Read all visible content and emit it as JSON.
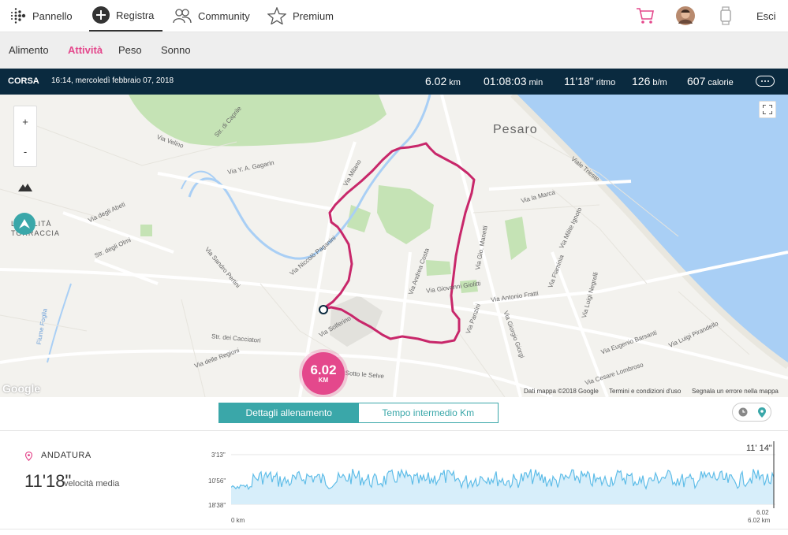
{
  "nav": {
    "items": [
      {
        "label": "Pannello",
        "icon": "dots-logo-icon"
      },
      {
        "label": "Registra",
        "icon": "plus-circle-icon"
      },
      {
        "label": "Community",
        "icon": "people-icon"
      },
      {
        "label": "Premium",
        "icon": "star-icon"
      }
    ],
    "logout": "Esci"
  },
  "subnav": [
    "Alimento",
    "Attività",
    "Peso",
    "Sonno"
  ],
  "activity": {
    "type": "CORSA",
    "datetime": "16:14, mercoledì febbraio 07, 2018",
    "distance": {
      "value": "6.02",
      "unit": "km"
    },
    "duration": {
      "value": "01:08:03",
      "unit": "min"
    },
    "pace": {
      "value": "11'18\"",
      "unit": "ritmo"
    },
    "heart_rate": {
      "value": "126",
      "unit": "b/m"
    },
    "calories": {
      "value": "607",
      "unit": "calorie"
    }
  },
  "map": {
    "zoom_in": "+",
    "zoom_out": "-",
    "marker_value": "6.02",
    "marker_unit": "KM",
    "labels": {
      "city": "Pesaro",
      "locality": "LOCALITÀ TORRACCIA",
      "google": "Google"
    },
    "streets": [
      "Via Y. A. Gagarin",
      "Via Milano",
      "Via degli Abeti",
      "Str. degli Olmi",
      "Via Sandro Pertini",
      "Via Niccolò Paganini",
      "Via Andrea Costa",
      "Via Giovanni Giolitti",
      "Via Antonio Fratti",
      "Via la Marca",
      "Viale Trieste",
      "Via Flaminia",
      "Via Luigi Negrelli",
      "Via Eugenio Barsanti",
      "Via Luigi Pirandello",
      "Via Cesare Lombroso",
      "Str. dei Cacciatori",
      "Via delle Regioni",
      "Str. di Sotto le Selve",
      "Fiume Foglia",
      "Via Velino",
      "Str. di Caprile",
      "Via Solferino",
      "Via Gio. Manetti",
      "Via Giorgio Giorgi",
      "Via Panzini",
      "Via Milite Ignoto"
    ],
    "footer": {
      "data": "Dati mappa ©2018 Google",
      "terms": "Termini e condizioni d'uso",
      "report": "Segnala un errore nella mappa"
    }
  },
  "tabs": {
    "details": "Dettagli allenamento",
    "splits": "Tempo intermedio Km"
  },
  "pace_section": {
    "title": "ANDATURA",
    "value": "11'18\"",
    "subtitle": "velocità media",
    "y_labels": [
      "3'13\"",
      "10'56\"",
      "18'38\""
    ],
    "x_start": "0 km",
    "x_end": "6.02 km",
    "cursor_value": "11' 14\"",
    "cursor_end": "6.02"
  },
  "chart_data": {
    "type": "area",
    "title": "ANDATURA",
    "x_range": [
      0,
      6.02
    ],
    "xlabel": "",
    "ylabel": "",
    "y_ticks": [
      "3'13\"",
      "10'56\"",
      "18'38\""
    ],
    "y_axis_inverted": true,
    "series": [
      {
        "values_description": "pace fluctuates around 10'56\" between approximately 9' and 13' per km"
      }
    ],
    "color": "#7ecbee"
  },
  "colors": {
    "accent": "#e4488c",
    "teal": "#3aa7a9",
    "dark": "#0a2a3f",
    "route": "#c8276a",
    "chart_fill": "#d7eefa",
    "chart_line": "#5fbde8"
  }
}
